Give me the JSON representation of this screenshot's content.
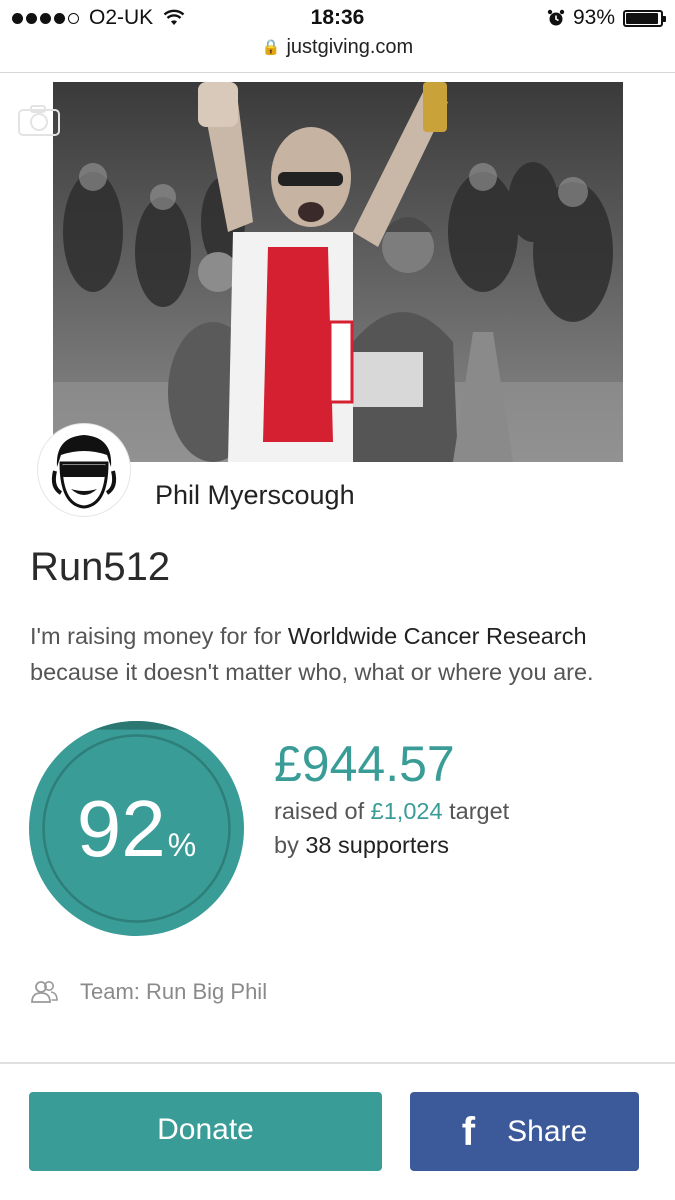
{
  "status_bar": {
    "carrier": "O2-UK",
    "time": "18:36",
    "battery": "93%",
    "battery_level": 0.93
  },
  "browser": {
    "url": "justgiving.com"
  },
  "profile": {
    "name": "Phil Myerscough"
  },
  "page": {
    "title": "Run512",
    "description_prefix": "I'm raising money for for ",
    "charity": "Worldwide Cancer Research",
    "description_suffix": " because it doesn't matter who, what or where you are."
  },
  "fundraising": {
    "percent": "92",
    "percent_symbol": "%",
    "progress_value": 0.92,
    "raised": "£944.57",
    "raised_of_prefix": "raised of ",
    "target": "£1,024",
    "target_suffix": " target",
    "by_prefix": "by ",
    "supporters": "38 supporters"
  },
  "team": {
    "label": "Team: Run Big Phil"
  },
  "actions": {
    "donate_label": "Donate",
    "share_label": "Share"
  },
  "colors": {
    "accent": "#3a9c97",
    "facebook": "#3c5a99"
  }
}
